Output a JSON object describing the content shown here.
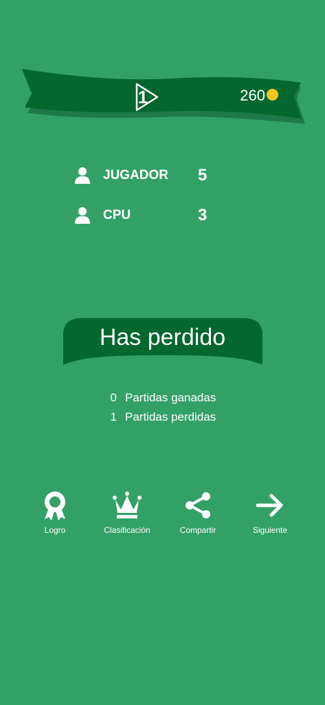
{
  "header": {
    "level": "1",
    "coins": "260"
  },
  "players": [
    {
      "name": "JUGADOR",
      "score": "5"
    },
    {
      "name": "CPU",
      "score": "3"
    }
  ],
  "result": {
    "title": "Has perdido"
  },
  "stats": [
    {
      "value": "0",
      "label": "Partidas ganadas"
    },
    {
      "value": "1",
      "label": "Partidas perdidas"
    }
  ],
  "actions": [
    {
      "label": "Logro",
      "icon": "award-ribbon-icon"
    },
    {
      "label": "Clasificación",
      "icon": "crown-icon"
    },
    {
      "label": "Compartir",
      "icon": "share-icon"
    },
    {
      "label": "Siguiente",
      "icon": "arrow-right-icon"
    }
  ],
  "colors": {
    "background": "#33a166",
    "banner_dark": "#04682e",
    "banner_shadow": "#1d7a48",
    "coin": "#f7c51b",
    "text": "#ffffff"
  }
}
